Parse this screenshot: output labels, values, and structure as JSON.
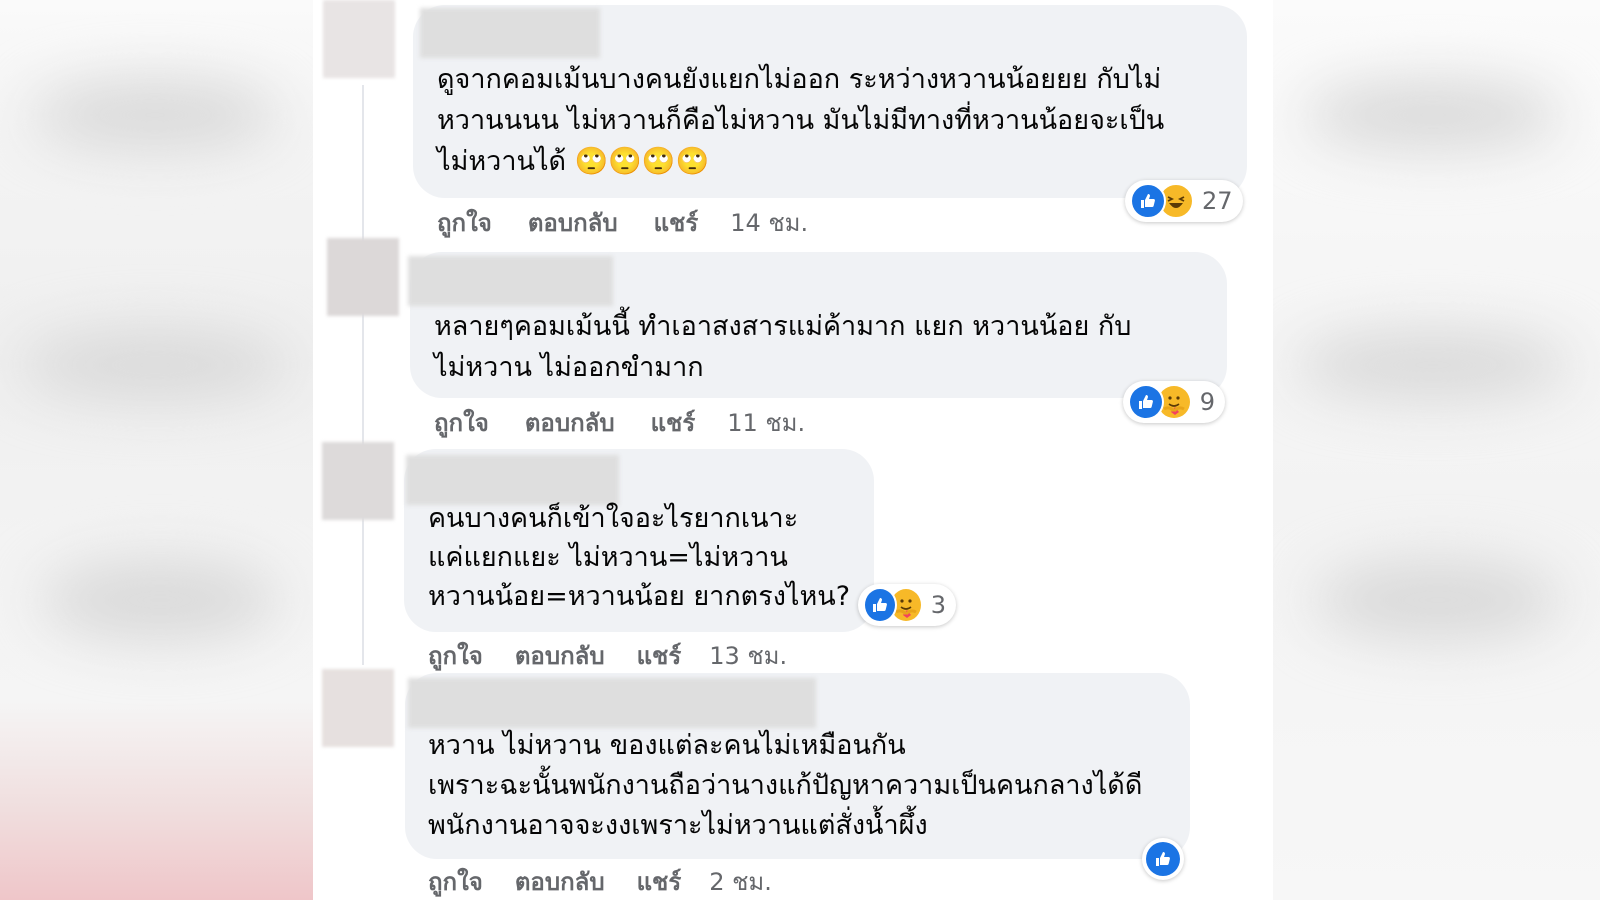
{
  "colors": {
    "bubble": "#f0f2f5",
    "like": "#1b74e4",
    "emoji": "#f7b928",
    "meta_text": "#65676b",
    "body_text": "#050505"
  },
  "actions": {
    "like": "ถูกใจ",
    "reply": "ตอบกลับ",
    "share": "แชร์"
  },
  "comments": [
    {
      "lines": [
        "ดูจากคอมเม้นบางคนยังแยกไม่ออก ระหว่างหวานน้อยยย กับไม่",
        "หวานนนน ไม่หวานก็คือไม่หวาน มันไม่มีทางที่หวานน้อยจะเป็น",
        "ไม่หวานได้ 🙄🙄🙄🙄"
      ],
      "reactions": [
        "like-icon",
        "haha-icon"
      ],
      "reaction_count": "27",
      "time": "14 ชม."
    },
    {
      "lines": [
        "หลายๆคอมเม้นนี้ ทำเอาสงสารแม่ค้ามาก แยก หวานน้อย กับ",
        "ไม่หวาน ไม่ออกขำมาก"
      ],
      "reactions": [
        "like-icon",
        "care-icon"
      ],
      "reaction_count": "9",
      "time": "11 ชม."
    },
    {
      "lines": [
        "คนบางคนก็เข้าใจอะไรยากเนาะ",
        "แค่แยกแยะ ไม่หวาน=ไม่หวาน",
        "หวานน้อย=หวานน้อย ยากตรงไหน?"
      ],
      "reactions": [
        "like-icon",
        "care-icon"
      ],
      "reaction_count": "3",
      "time": "13 ชม."
    },
    {
      "lines": [
        "หวาน ไม่หวาน ของแต่ละคนไม่เหมือนกัน",
        "เพราะฉะนั้นพนักงานถือว่านางแก้ปัญหาความเป็นคนกลางได้ดี",
        "พนักงานอาจจะงงเพราะไม่หวานแต่สั่งน้ำผึ้ง"
      ],
      "reactions": [
        "like-icon"
      ],
      "reaction_count": "",
      "time": "2 ชม."
    }
  ]
}
